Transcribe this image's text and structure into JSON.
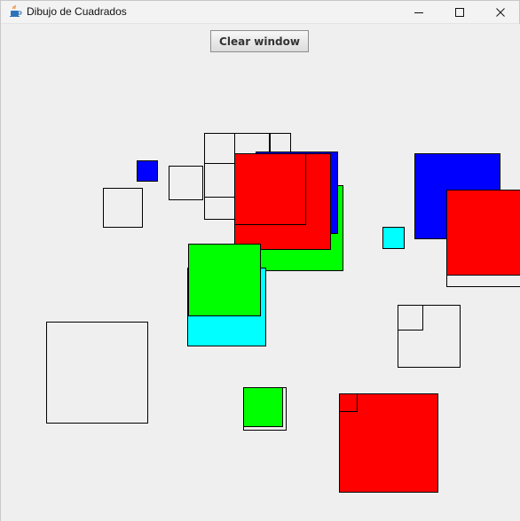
{
  "window": {
    "title": "Dibujo de Cuadrados",
    "controls": {
      "minimize_icon": "minimize-icon",
      "maximize_icon": "maximize-icon",
      "close_icon": "close-icon"
    }
  },
  "toolbar": {
    "clear_label": "Clear window"
  },
  "colors": {
    "background": "#efefef",
    "blue": "#0000ff",
    "red": "#ff0000",
    "green": "#00ff00",
    "cyan": "#00ffff",
    "outline": "#000000"
  },
  "drawing": {
    "square_count": 27
  }
}
